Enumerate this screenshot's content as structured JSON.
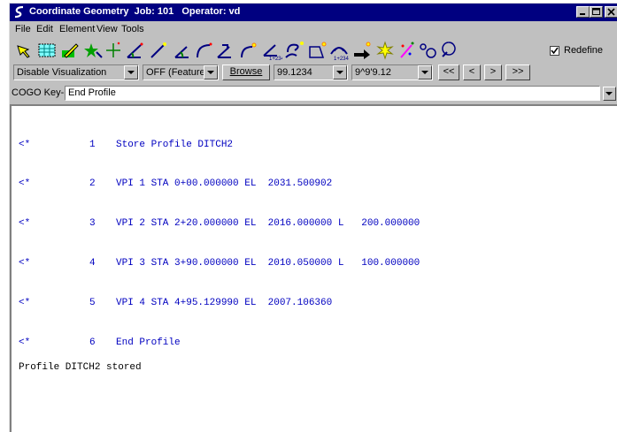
{
  "window": {
    "title": "Coordinate Geometry  Job: 101   Operator: vd"
  },
  "menu": {
    "items": [
      {
        "label": "File"
      },
      {
        "label": "Edit"
      },
      {
        "label": "Element"
      },
      {
        "label": "View"
      },
      {
        "label": "Tools"
      }
    ]
  },
  "toolbar": {
    "icons": [
      "select-icon",
      "grid-select-icon",
      "edit-pencil-icon",
      "star-point-icon",
      "plus-point-icon",
      "line-angle-icon",
      "line-icon",
      "arc-angle-icon",
      "curve-icon",
      "arc-bracket-icon",
      "curve-spark-icon",
      "station-curve-icon",
      "spiral-icon",
      "box-spark-icon",
      "station-arc-icon",
      "arrow-spark-icon",
      "burst-icon",
      "magic-wand-icon",
      "lasso-icon",
      "locate-icon"
    ],
    "redefine_label": "Redefine",
    "redefine_checked": true
  },
  "controls": {
    "visualization": "Disable Visualization",
    "feature": "OFF (Feature)",
    "browse_label": "Browse",
    "distance": "99.1234",
    "angle": "9^9'9.12",
    "nav_first": "<<",
    "nav_prev": "<",
    "nav_next": ">",
    "nav_last": ">>"
  },
  "keyin": {
    "label": "COGO Key-in:",
    "value": "End Profile"
  },
  "output": {
    "lines": [
      {
        "marker": "<*",
        "num": "1",
        "text": "Store Profile DITCH2"
      },
      {
        "marker": "<*",
        "num": "2",
        "text": "VPI 1 STA 0+00.000000 EL  2031.500902"
      },
      {
        "marker": "<*",
        "num": "3",
        "text": "VPI 2 STA 2+20.000000 EL  2016.000000 L   200.000000"
      },
      {
        "marker": "<*",
        "num": "4",
        "text": "VPI 3 STA 3+90.000000 EL  2010.050000 L   100.000000"
      },
      {
        "marker": "<*",
        "num": "5",
        "text": "VPI 4 STA 4+95.129990 EL  2007.106360"
      },
      {
        "marker": "<*",
        "num": "6",
        "text": "End Profile"
      }
    ],
    "status": "Profile DITCH2 stored"
  }
}
